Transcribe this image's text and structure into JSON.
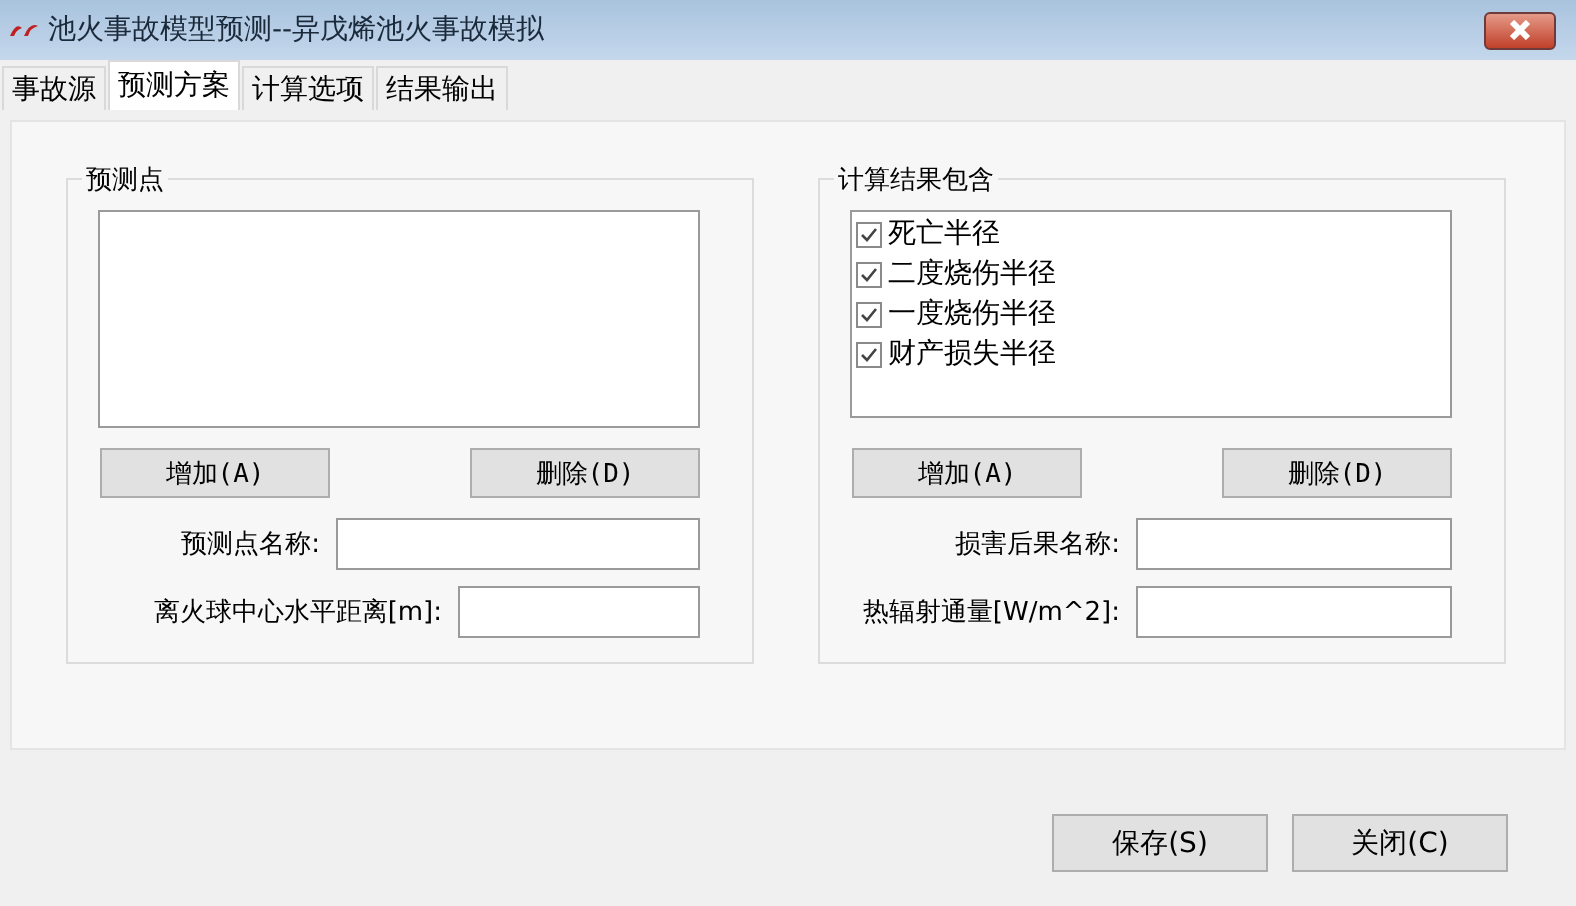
{
  "window": {
    "title": "池火事故模型预测--异戊烯池火事故模拟"
  },
  "tabs": [
    {
      "label": "事故源",
      "selected": false
    },
    {
      "label": "预测方案",
      "selected": true
    },
    {
      "label": "计算选项",
      "selected": false
    },
    {
      "label": "结果输出",
      "selected": false
    }
  ],
  "groups": [
    {
      "title": "预测点",
      "buttons": [
        "增加(A)",
        "删除(D)"
      ],
      "fields": [
        {
          "label": "预测点名称:"
        },
        {
          "label": "离火球中心水平距离[m]:"
        }
      ]
    },
    {
      "title": "计算结果包含",
      "list_items": [
        {
          "label": "死亡半径",
          "checked": true
        },
        {
          "label": "二度烧伤半径",
          "checked": true
        },
        {
          "label": "一度烧伤半径",
          "checked": true
        },
        {
          "label": "财产损失半径",
          "checked": true
        }
      ],
      "buttons": [
        "增加(A)",
        "删除(D)"
      ],
      "fields": [
        {
          "label": "损害后果名称:"
        },
        {
          "label": "热辐射通量[W/m^2]:"
        }
      ]
    }
  ],
  "buttons": [
    "保存(S)",
    "关闭(C)"
  ]
}
